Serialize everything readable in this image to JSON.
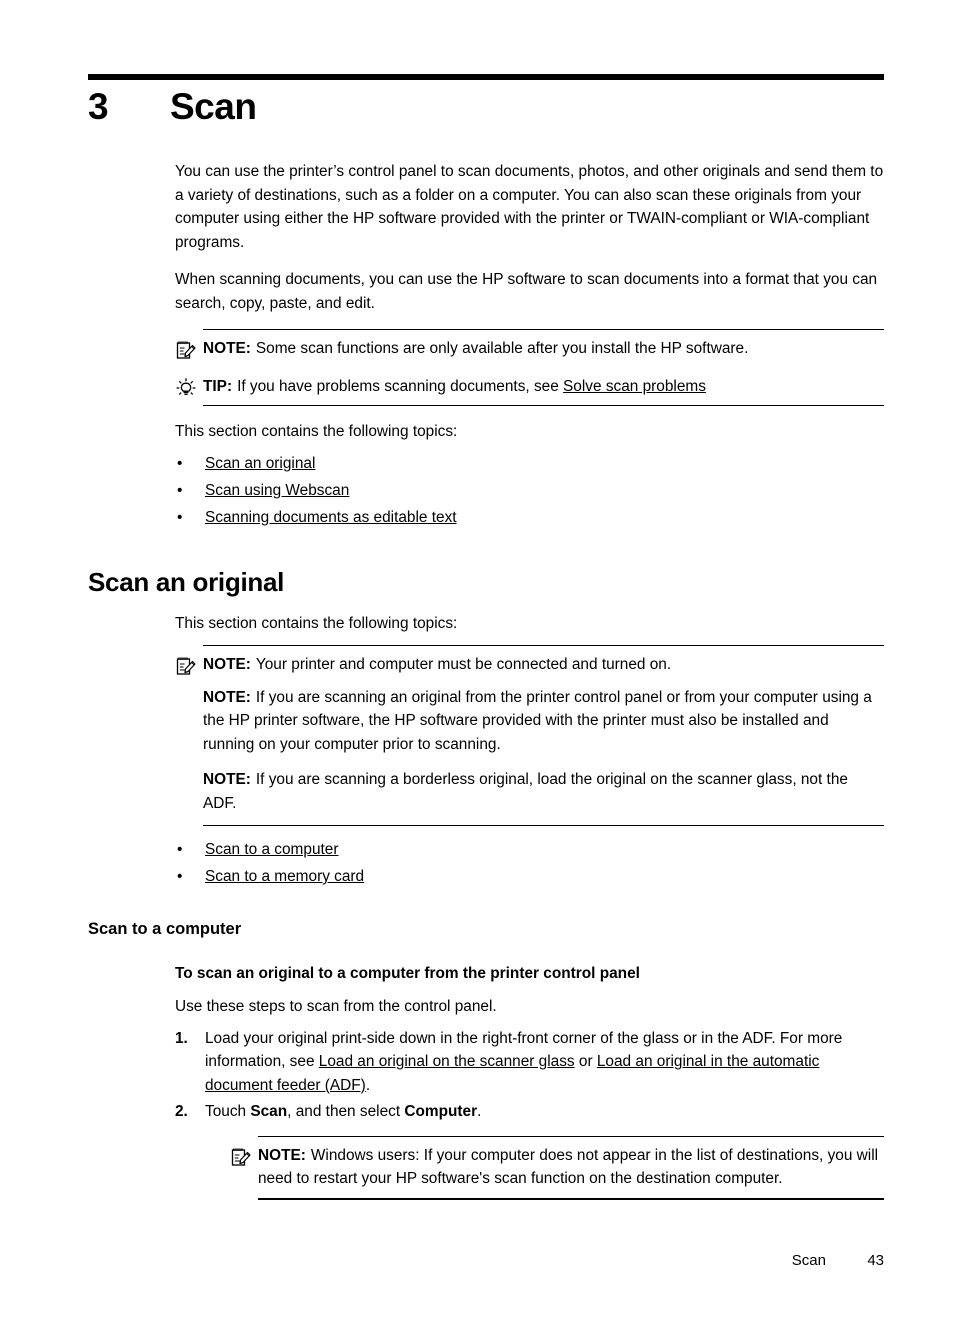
{
  "chapter": {
    "number": "3",
    "title": "Scan"
  },
  "intro": {
    "paragraph_1": "You can use the printer’s control panel to scan documents, photos, and other originals and send them to a variety of destinations, such as a folder on a computer. You can also scan these originals from your computer using either the HP software provided with the printer or TWAIN-compliant or WIA-compliant programs.",
    "paragraph_2": "When scanning documents, you can use the HP software to scan documents into a format that you can search, copy, paste, and edit."
  },
  "intro_callouts": {
    "note": {
      "icon": "note-pad-pencil-icon",
      "label": "NOTE:",
      "text": "Some scan functions are only available after you install the HP software."
    },
    "tip": {
      "icon": "lightbulb-icon",
      "label": "TIP:",
      "text_before_link": "If you have problems scanning documents, see ",
      "link": "Solve scan problems"
    }
  },
  "topics_intro": {
    "lead": "This section contains the following topics:",
    "bullet": "•",
    "items": [
      "Scan an original",
      "Scan using Webscan",
      "Scanning documents as editable text"
    ]
  },
  "section_scan_original": {
    "heading": "Scan an original",
    "lead": "This section contains the following topics:",
    "notes": [
      {
        "icon": "note-pad-pencil-icon",
        "label": "NOTE:",
        "text": "Your printer and computer must be connected and turned on."
      },
      {
        "label": "NOTE:",
        "text": "If you are scanning an original from the printer control panel or from your computer using a the HP printer software, the HP software provided with the printer must also be installed and running on your computer prior to scanning."
      },
      {
        "label": "NOTE:",
        "text": "If you are scanning a borderless original, load the original on the scanner glass, not the ADF."
      }
    ],
    "bullet": "•",
    "items": [
      "Scan to a computer",
      "Scan to a memory card"
    ]
  },
  "subsection_scan_to_computer": {
    "heading": "Scan to a computer",
    "procedure_title": "To scan an original to a computer from the printer control panel",
    "lead": "Use these steps to scan from the control panel.",
    "steps": [
      {
        "number": "1.",
        "text_1": "Load your original print-side down in the right-front corner of the glass or in the ADF. For more information, see ",
        "link_1": "Load an original on the scanner glass",
        "text_2": " or ",
        "link_2": "Load an original in the automatic document feeder (ADF)",
        "text_3": "."
      },
      {
        "number": "2.",
        "text_1": "Touch ",
        "bold_1": "Scan",
        "text_2": ", and then select ",
        "bold_2": "Computer",
        "text_3": "."
      }
    ],
    "step_note": {
      "icon": "note-pad-pencil-icon",
      "label": "NOTE:",
      "text": "Windows users: If your computer does not appear in the list of destinations, you will need to restart your HP software's scan function on the destination computer."
    }
  },
  "footer": {
    "chapter_name": "Scan",
    "page_number": "43"
  },
  "colors": {
    "text": "#000000",
    "rule": "#000000",
    "background": "#ffffff"
  }
}
